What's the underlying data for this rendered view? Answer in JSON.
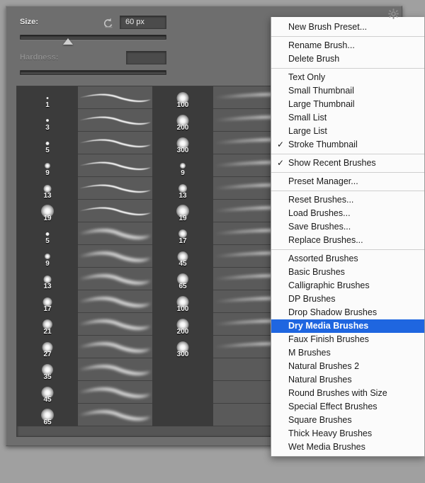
{
  "panel": {
    "name": "brush-preset-picker"
  },
  "controls": {
    "size_label": "Size:",
    "size_value": "60 px",
    "size_slider_percent": 33,
    "reset_icon": "reset-arrow-icon",
    "hardness_label": "Hardness:",
    "hardness_value": "",
    "hardness_slider_percent": 0
  },
  "gear": {
    "icon": "gear-icon"
  },
  "brush_rows": [
    {
      "a_num": "1",
      "a_size": 3,
      "c_num": "100",
      "c_size": 17
    },
    {
      "a_num": "3",
      "a_size": 4,
      "c_num": "200",
      "c_size": 17
    },
    {
      "a_num": "5",
      "a_size": 5,
      "c_num": "300",
      "c_size": 17
    },
    {
      "a_num": "9",
      "a_size": 8,
      "c_num": "9",
      "c_size": 8
    },
    {
      "a_num": "13",
      "a_size": 11,
      "c_num": "13",
      "c_size": 12
    },
    {
      "a_num": "19",
      "a_size": 18,
      "c_num": "19",
      "c_size": 18
    },
    {
      "a_num": "5",
      "a_size": 5,
      "c_num": "17",
      "c_size": 12
    },
    {
      "a_num": "9",
      "a_size": 8,
      "c_num": "45",
      "c_size": 15
    },
    {
      "a_num": "13",
      "a_size": 11,
      "c_num": "65",
      "c_size": 16
    },
    {
      "a_num": "17",
      "a_size": 13,
      "c_num": "100",
      "c_size": 17
    },
    {
      "a_num": "21",
      "a_size": 14,
      "c_num": "200",
      "c_size": 17
    },
    {
      "a_num": "27",
      "a_size": 15,
      "c_num": "300",
      "c_size": 17
    },
    {
      "a_num": "35",
      "a_size": 16,
      "c_num": "",
      "c_size": 0
    },
    {
      "a_num": "45",
      "a_size": 17,
      "c_num": "",
      "c_size": 0
    },
    {
      "a_num": "65",
      "a_size": 18,
      "c_num": "",
      "c_size": 0
    }
  ],
  "menu": {
    "groups": [
      {
        "items": [
          {
            "label": "New Brush Preset...",
            "checked": false,
            "selected": false
          }
        ]
      },
      {
        "items": [
          {
            "label": "Rename Brush...",
            "checked": false,
            "selected": false
          },
          {
            "label": "Delete Brush",
            "checked": false,
            "selected": false
          }
        ]
      },
      {
        "items": [
          {
            "label": "Text Only",
            "checked": false,
            "selected": false
          },
          {
            "label": "Small Thumbnail",
            "checked": false,
            "selected": false
          },
          {
            "label": "Large Thumbnail",
            "checked": false,
            "selected": false
          },
          {
            "label": "Small List",
            "checked": false,
            "selected": false
          },
          {
            "label": "Large List",
            "checked": false,
            "selected": false
          },
          {
            "label": "Stroke Thumbnail",
            "checked": true,
            "selected": false
          }
        ]
      },
      {
        "items": [
          {
            "label": "Show Recent Brushes",
            "checked": true,
            "selected": false
          }
        ]
      },
      {
        "items": [
          {
            "label": "Preset Manager...",
            "checked": false,
            "selected": false
          }
        ]
      },
      {
        "items": [
          {
            "label": "Reset Brushes...",
            "checked": false,
            "selected": false
          },
          {
            "label": "Load Brushes...",
            "checked": false,
            "selected": false
          },
          {
            "label": "Save Brushes...",
            "checked": false,
            "selected": false
          },
          {
            "label": "Replace Brushes...",
            "checked": false,
            "selected": false
          }
        ]
      },
      {
        "items": [
          {
            "label": "Assorted Brushes",
            "checked": false,
            "selected": false
          },
          {
            "label": "Basic Brushes",
            "checked": false,
            "selected": false
          },
          {
            "label": "Calligraphic Brushes",
            "checked": false,
            "selected": false
          },
          {
            "label": "DP Brushes",
            "checked": false,
            "selected": false
          },
          {
            "label": "Drop Shadow Brushes",
            "checked": false,
            "selected": false
          },
          {
            "label": "Dry Media Brushes",
            "checked": false,
            "selected": true
          },
          {
            "label": "Faux Finish Brushes",
            "checked": false,
            "selected": false
          },
          {
            "label": "M Brushes",
            "checked": false,
            "selected": false
          },
          {
            "label": "Natural Brushes 2",
            "checked": false,
            "selected": false
          },
          {
            "label": "Natural Brushes",
            "checked": false,
            "selected": false
          },
          {
            "label": "Round Brushes with Size",
            "checked": false,
            "selected": false
          },
          {
            "label": "Special Effect Brushes",
            "checked": false,
            "selected": false
          },
          {
            "label": "Square Brushes",
            "checked": false,
            "selected": false
          },
          {
            "label": "Thick Heavy Brushes",
            "checked": false,
            "selected": false
          },
          {
            "label": "Wet Media Brushes",
            "checked": false,
            "selected": false
          }
        ]
      }
    ],
    "check_glyph": "✓"
  },
  "colors": {
    "panel_bg": "#6e6e6e",
    "list_bg": "#5a5a5a",
    "tip_cell_bg": "#3b3b3b",
    "menu_bg": "#fbfbfb",
    "menu_highlight": "#1f66e0",
    "text_light": "#e8e8e8",
    "desktop_bg": "#a0a0a0"
  }
}
